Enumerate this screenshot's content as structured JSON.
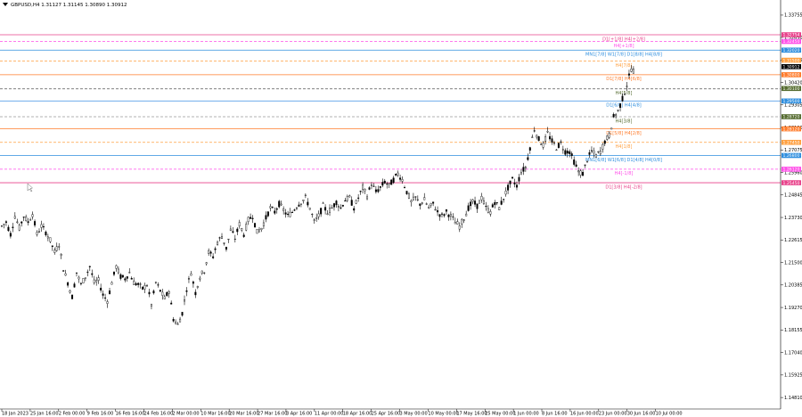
{
  "chart_data": {
    "type": "candlestick",
    "symbol_info": "GBPUSD,H4  1.31127 1.31145 1.30890 1.30912",
    "y_ticks": [
      "1.33755",
      "1.32650",
      "1.31535",
      "1.30420",
      "1.29305",
      "1.28190",
      "1.27075",
      "1.25960",
      "1.24845",
      "1.23730",
      "1.22615",
      "1.21500",
      "1.20385",
      "1.19270",
      "1.18155",
      "1.17040",
      "1.15925",
      "1.14810"
    ],
    "ylim": [
      1.1455,
      1.3415
    ],
    "x_ticks": [
      "18 Jan 2023",
      "25 Jan 16:00",
      "2 Feb 00:00",
      "9 Feb 16:00",
      "16 Feb 16:00",
      "24 Feb 16:00",
      "2 Mar 00:00",
      "10 Mar 16:00",
      "20 Mar 16:00",
      "27 Mar 16:00",
      "3 Apr 16:00",
      "11 Apr 00:00",
      "18 Apr 16:00",
      "25 Apr 16:00",
      "3 May 00:00",
      "10 May 00:00",
      "17 May 16:00",
      "25 May 00:00",
      "1 Jun 00:00",
      "8 Jun 16:00",
      "16 Jun 00:00",
      "23 Jun 00:00",
      "30 Jun 16:00",
      "10 Jul 00:00"
    ],
    "price_path": [
      [
        0,
        1.233
      ],
      [
        5,
        1.235
      ],
      [
        10,
        1.229
      ],
      [
        15,
        1.238
      ],
      [
        20,
        1.232
      ],
      [
        25,
        1.238
      ],
      [
        30,
        1.235
      ],
      [
        35,
        1.239
      ],
      [
        40,
        1.229
      ],
      [
        45,
        1.233
      ],
      [
        50,
        1.23
      ],
      [
        55,
        1.226
      ],
      [
        60,
        1.22
      ],
      [
        65,
        1.224
      ],
      [
        70,
        1.212
      ],
      [
        75,
        1.205
      ],
      [
        80,
        1.198
      ],
      [
        85,
        1.21
      ],
      [
        90,
        1.204
      ],
      [
        95,
        1.208
      ],
      [
        100,
        1.213
      ],
      [
        105,
        1.205
      ],
      [
        110,
        1.206
      ],
      [
        115,
        1.199
      ],
      [
        120,
        1.196
      ],
      [
        125,
        1.205
      ],
      [
        130,
        1.213
      ],
      [
        135,
        1.208
      ],
      [
        140,
        1.207
      ],
      [
        145,
        1.21
      ],
      [
        150,
        1.205
      ],
      [
        155,
        1.204
      ],
      [
        160,
        1.202
      ],
      [
        165,
        1.204
      ],
      [
        170,
        1.194
      ],
      [
        175,
        1.205
      ],
      [
        180,
        1.201
      ],
      [
        185,
        1.197
      ],
      [
        190,
        1.201
      ],
      [
        195,
        1.187
      ],
      [
        200,
        1.184
      ],
      [
        205,
        1.19
      ],
      [
        210,
        1.202
      ],
      [
        215,
        1.21
      ],
      [
        220,
        1.2
      ],
      [
        225,
        1.208
      ],
      [
        230,
        1.211
      ],
      [
        235,
        1.22
      ],
      [
        240,
        1.218
      ],
      [
        245,
        1.225
      ],
      [
        250,
        1.228
      ],
      [
        255,
        1.222
      ],
      [
        260,
        1.231
      ],
      [
        265,
        1.227
      ],
      [
        270,
        1.234
      ],
      [
        275,
        1.229
      ],
      [
        280,
        1.236
      ],
      [
        285,
        1.238
      ],
      [
        290,
        1.23
      ],
      [
        295,
        1.232
      ],
      [
        300,
        1.237
      ],
      [
        305,
        1.242
      ],
      [
        310,
        1.24
      ],
      [
        315,
        1.244
      ],
      [
        320,
        1.241
      ],
      [
        325,
        1.238
      ],
      [
        330,
        1.24
      ],
      [
        335,
        1.243
      ],
      [
        340,
        1.245
      ],
      [
        345,
        1.247
      ],
      [
        350,
        1.242
      ],
      [
        355,
        1.235
      ],
      [
        360,
        1.238
      ],
      [
        365,
        1.243
      ],
      [
        370,
        1.24
      ],
      [
        375,
        1.242
      ],
      [
        380,
        1.245
      ],
      [
        385,
        1.242
      ],
      [
        390,
        1.246
      ],
      [
        395,
        1.247
      ],
      [
        400,
        1.242
      ],
      [
        405,
        1.247
      ],
      [
        410,
        1.252
      ],
      [
        415,
        1.248
      ],
      [
        420,
        1.254
      ],
      [
        425,
        1.25
      ],
      [
        430,
        1.252
      ],
      [
        435,
        1.255
      ],
      [
        440,
        1.253
      ],
      [
        445,
        1.256
      ],
      [
        450,
        1.259
      ],
      [
        455,
        1.256
      ],
      [
        460,
        1.25
      ],
      [
        465,
        1.245
      ],
      [
        470,
        1.247
      ],
      [
        475,
        1.244
      ],
      [
        480,
        1.246
      ],
      [
        485,
        1.242
      ],
      [
        490,
        1.244
      ],
      [
        495,
        1.24
      ],
      [
        500,
        1.238
      ],
      [
        505,
        1.24
      ],
      [
        510,
        1.238
      ],
      [
        515,
        1.235
      ],
      [
        520,
        1.233
      ],
      [
        525,
        1.237
      ],
      [
        530,
        1.242
      ],
      [
        535,
        1.245
      ],
      [
        540,
        1.243
      ],
      [
        545,
        1.247
      ],
      [
        550,
        1.242
      ],
      [
        555,
        1.24
      ],
      [
        560,
        1.245
      ],
      [
        565,
        1.242
      ],
      [
        570,
        1.247
      ],
      [
        575,
        1.252
      ],
      [
        580,
        1.256
      ],
      [
        585,
        1.253
      ],
      [
        590,
        1.26
      ],
      [
        595,
        1.262
      ],
      [
        600,
        1.272
      ],
      [
        605,
        1.281
      ],
      [
        610,
        1.276
      ],
      [
        615,
        1.273
      ],
      [
        620,
        1.279
      ],
      [
        625,
        1.275
      ],
      [
        630,
        1.272
      ],
      [
        635,
        1.274
      ],
      [
        640,
        1.27
      ],
      [
        645,
        1.27
      ],
      [
        650,
        1.265
      ],
      [
        655,
        1.26
      ],
      [
        660,
        1.259
      ],
      [
        665,
        1.266
      ],
      [
        670,
        1.27
      ],
      [
        675,
        1.268
      ],
      [
        680,
        1.27
      ],
      [
        685,
        1.275
      ],
      [
        690,
        1.278
      ],
      [
        695,
        1.287
      ],
      [
        700,
        1.29
      ],
      [
        705,
        1.296
      ],
      [
        710,
        1.303
      ],
      [
        715,
        1.311
      ],
      [
        720,
        1.309
      ]
    ],
    "levels": [
      {
        "label": "D1[+1/8] H4[+2/8]",
        "price": 1.3278,
        "color": "#e8418a",
        "style": "solid",
        "label_color": "#e8418a"
      },
      {
        "label": "H4[+1/8]",
        "price": 1.3245,
        "color": "#ff4fe8",
        "style": "dashed",
        "label_color": "#ff4fe8"
      },
      {
        "label": "MN1[7/8] W1[7/8] D1[8/8] H4[8/8]",
        "price": 1.3202,
        "color": "#2e8ede",
        "style": "solid",
        "label_color": "#2e8ede"
      },
      {
        "label": "H4[7/8]",
        "price": 1.3148,
        "color": "#ffa040",
        "style": "dashed",
        "label_color": "#ffa040"
      },
      {
        "label": "D1[7/8] H4[6/8]",
        "price": 1.308,
        "color": "#ff7b2a",
        "style": "solid",
        "label_color": "#ff7b2a"
      },
      {
        "label": "H4[5/8]",
        "price": 1.301,
        "color": "#555555",
        "style": "dashed",
        "label_color": "#556b2f"
      },
      {
        "label": "D1[6/8] H4[4/8]",
        "price": 1.295,
        "color": "#5aa0e8",
        "style": "solid",
        "label_color": "#2e8ede"
      },
      {
        "label": "H4[3/8]",
        "price": 1.2872,
        "color": "#999999",
        "style": "dashed",
        "label_color": "#556b2f"
      },
      {
        "label": "D1[5/8] H4[2/8]",
        "price": 1.2812,
        "color": "#ff7b2a",
        "style": "solid",
        "label_color": "#ff7b2a"
      },
      {
        "label": "H4[1/8]",
        "price": 1.2745,
        "color": "#ffa040",
        "style": "dashed",
        "label_color": "#ffa040"
      },
      {
        "label": "MN1[6/8] W1[6/8] D1[4/8] H4[0/8]",
        "price": 1.268,
        "color": "#2e8ede",
        "style": "solid",
        "label_color": "#2e8ede"
      },
      {
        "label": "H4[-1/8]",
        "price": 1.2612,
        "color": "#ff4fe8",
        "style": "dashed",
        "label_color": "#ff4fe8"
      },
      {
        "label": "D1[3/8] H4[-2/8]",
        "price": 1.2545,
        "color": "#e8418a",
        "style": "solid",
        "label_color": "#e8418a"
      }
    ],
    "price_badges": [
      {
        "text": "1.32754",
        "price": 1.3278,
        "color": "#e8418a"
      },
      {
        "text": "1.32450",
        "price": 1.3245,
        "color": "#ff4fe8"
      },
      {
        "text": "1.32020",
        "price": 1.3202,
        "color": "#2e8ede"
      },
      {
        "text": "1.31500",
        "price": 1.3152,
        "color": "#ffa040"
      },
      {
        "text": "1.30912",
        "price": 1.312,
        "color": "#000000"
      },
      {
        "text": "1.30800",
        "price": 1.308,
        "color": "#ff7b2a"
      },
      {
        "text": "1.30100",
        "price": 1.3012,
        "color": "#556b2f"
      },
      {
        "text": "1.29500",
        "price": 1.295,
        "color": "#2e8ede"
      },
      {
        "text": "1.28720",
        "price": 1.2872,
        "color": "#556b2f"
      },
      {
        "text": "1.28120",
        "price": 1.2812,
        "color": "#ff7b2a"
      },
      {
        "text": "1.27450",
        "price": 1.2745,
        "color": "#ffa040"
      },
      {
        "text": "1.26800",
        "price": 1.268,
        "color": "#2e8ede"
      },
      {
        "text": "1.26120",
        "price": 1.2612,
        "color": "#ff4fe8"
      },
      {
        "text": "1.25450",
        "price": 1.2545,
        "color": "#e8418a"
      }
    ]
  }
}
